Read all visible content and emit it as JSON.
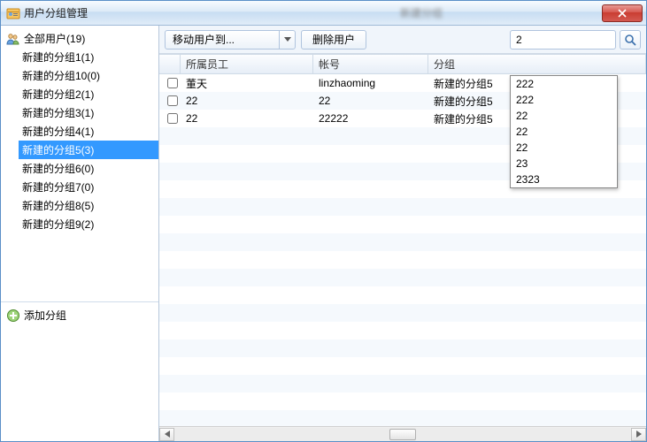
{
  "window": {
    "title": "用户分组管理"
  },
  "sidebar": {
    "root": "全部用户(19)",
    "items": [
      {
        "label": "新建的分组1(1)"
      },
      {
        "label": "新建的分组10(0)"
      },
      {
        "label": "新建的分组2(1)"
      },
      {
        "label": "新建的分组3(1)"
      },
      {
        "label": "新建的分组4(1)"
      },
      {
        "label": "新建的分组5(3)",
        "selected": true
      },
      {
        "label": "新建的分组6(0)"
      },
      {
        "label": "新建的分组7(0)"
      },
      {
        "label": "新建的分组8(5)"
      },
      {
        "label": "新建的分组9(2)"
      }
    ],
    "add_group": "添加分组"
  },
  "toolbar": {
    "move_label": "移动用户到...",
    "delete_label": "删除用户",
    "search_value": "2"
  },
  "grid": {
    "headers": {
      "employee": "所属员工",
      "account": "帐号",
      "group": "分组"
    },
    "rows": [
      {
        "employee": "董天",
        "account": "linzhaoming",
        "group": "新建的分组5"
      },
      {
        "employee": "22",
        "account": "22",
        "group": "新建的分组5"
      },
      {
        "employee": "22",
        "account": "22222",
        "group": "新建的分组5"
      }
    ]
  },
  "suggest": {
    "items": [
      "222",
      "222",
      "22",
      "22",
      "22",
      "23",
      "2323"
    ]
  }
}
